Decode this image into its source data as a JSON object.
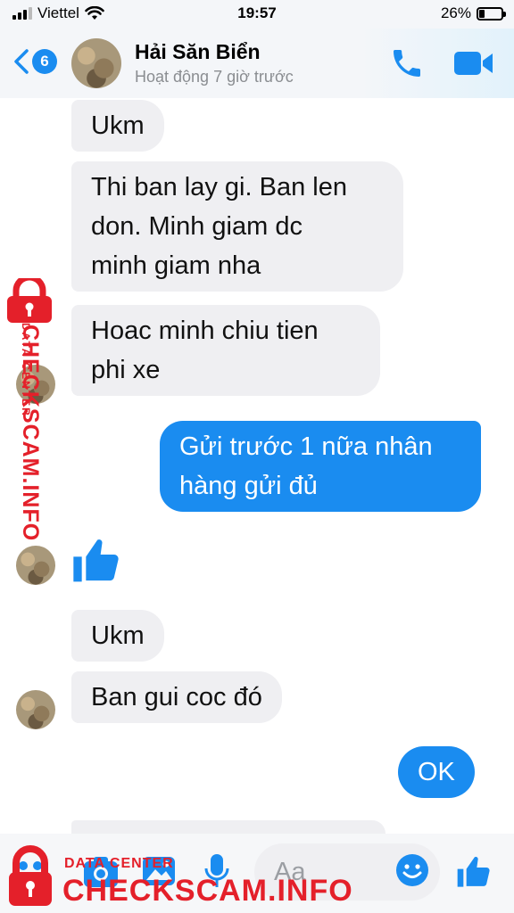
{
  "status_bar": {
    "carrier": "Viettel",
    "time": "19:57",
    "battery": "26%",
    "battery_level": 0.26
  },
  "header": {
    "back_count": "6",
    "name": "Hải Săn Biển",
    "status": "Hoạt động 7 giờ trước"
  },
  "messages": [
    {
      "from": "them",
      "text": "Ukm"
    },
    {
      "from": "them",
      "line1": "Thi ban lay gi. Ban len",
      "line2": "don. Minh giam dc",
      "line3": "minh giam nha"
    },
    {
      "from": "them",
      "line1": "Hoac minh chiu tien",
      "line2": "phi xe"
    },
    {
      "from": "me",
      "line1": "Gửi trước 1 nữa nhân",
      "line2": "hàng gửi đủ"
    },
    {
      "from": "them",
      "text": "Ukm"
    },
    {
      "from": "them",
      "text": "Ban gui coc đó"
    },
    {
      "from": "me",
      "text": "OK"
    }
  ],
  "composer": {
    "placeholder": "Aa"
  },
  "watermark": {
    "side_text": "CHECKSCAM.INFO",
    "side_small": "DATA CENTER",
    "bottom_small": "DATA CENTER",
    "bottom_text": "CHECKSCAM.INFO"
  },
  "colors": {
    "accent": "#1a8cf0",
    "incoming_bubble": "#efeff2",
    "watermark": "#e4202a"
  }
}
